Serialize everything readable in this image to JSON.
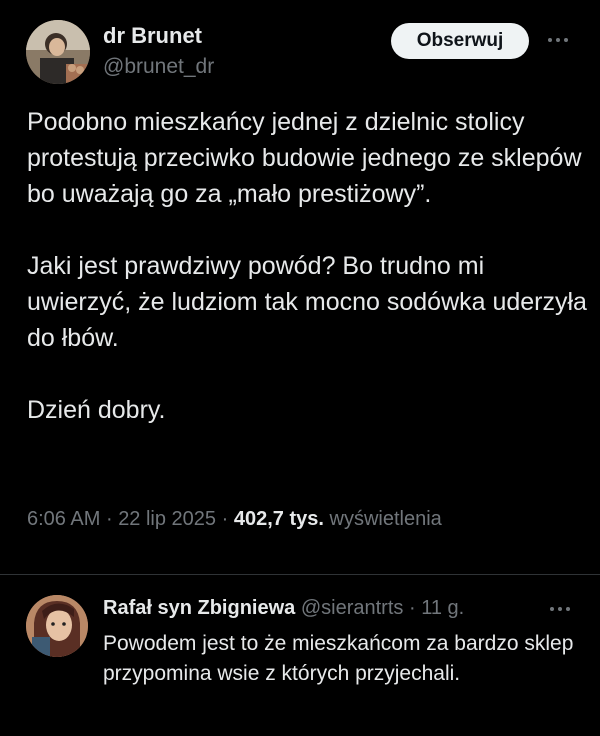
{
  "tweet": {
    "author_name": "dr Brunet",
    "author_handle": "@brunet_dr",
    "follow_label": "Obserwuj",
    "paragraphs": [
      "Podobno mieszkańcy jednej z dzielnic stolicy protestują przeciwko budowie jednego ze sklepów bo uważają go za „mało prestiżowy”.",
      "Jaki jest prawdziwy powód? Bo trudno mi uwierzyć, że ludziom tak mocno sodówka uderzyła do łbów.",
      "Dzień dobry."
    ],
    "time": "6:06 AM",
    "date": "22 lip 2025",
    "separator": "·",
    "views_count": "402,7 tys.",
    "views_label": "wyświetlenia"
  },
  "reply": {
    "author_name": "Rafał syn Zbigniewa",
    "author_handle": "@sierantrts",
    "separator": "·",
    "time": "11 g.",
    "text": "Powodem jest to że mieszkańcom za bardzo sklep przypomina wsie z których przyjechali."
  },
  "colors": {
    "background": "#000000",
    "text_primary": "#e7e9ea",
    "text_secondary": "#71767b",
    "button_bg": "#eff3f4",
    "divider": "#2f3336"
  },
  "icons": {
    "more_main": "more-horizontal-icon",
    "more_reply": "more-horizontal-icon"
  }
}
